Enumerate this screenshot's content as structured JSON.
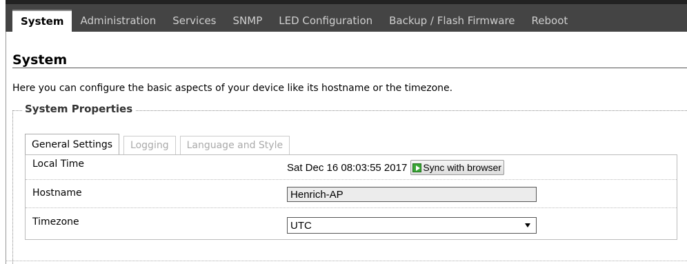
{
  "nav": {
    "tabs": [
      {
        "label": "System"
      },
      {
        "label": "Administration"
      },
      {
        "label": "Services"
      },
      {
        "label": "SNMP"
      },
      {
        "label": "LED Configuration"
      },
      {
        "label": "Backup / Flash Firmware"
      },
      {
        "label": "Reboot"
      }
    ]
  },
  "page": {
    "title": "System",
    "description": "Here you can configure the basic aspects of your device like its hostname or the timezone."
  },
  "fieldset": {
    "legend": "System Properties",
    "subtabs": [
      {
        "label": "General Settings"
      },
      {
        "label": "Logging"
      },
      {
        "label": "Language and Style"
      }
    ]
  },
  "settings": {
    "local_time": {
      "label": "Local Time",
      "value": "Sat Dec 16 08:03:55 2017",
      "sync_label": "Sync with browser"
    },
    "hostname": {
      "label": "Hostname",
      "value": "Henrich-AP"
    },
    "timezone": {
      "label": "Timezone",
      "value": "UTC"
    }
  },
  "colors": {
    "topbar": "#444444",
    "sync_icon": "#3aa636"
  }
}
